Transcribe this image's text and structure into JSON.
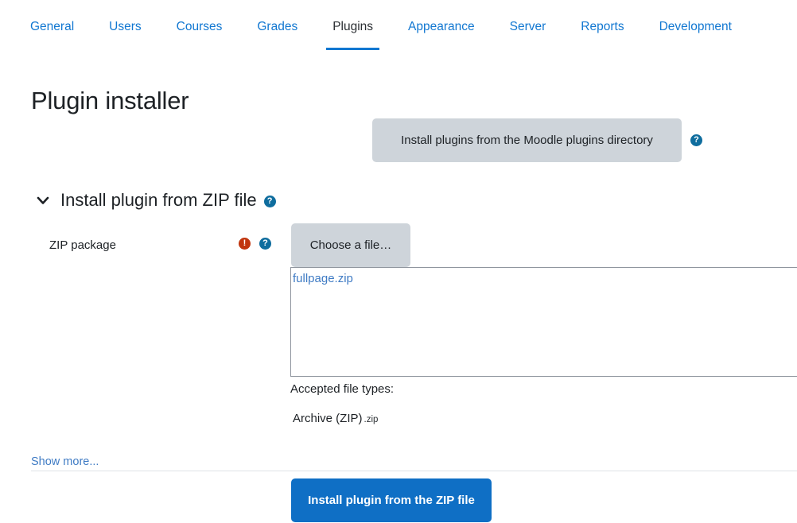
{
  "nav": {
    "tabs": [
      {
        "label": "General",
        "active": false
      },
      {
        "label": "Users",
        "active": false
      },
      {
        "label": "Courses",
        "active": false
      },
      {
        "label": "Grades",
        "active": false
      },
      {
        "label": "Plugins",
        "active": true
      },
      {
        "label": "Appearance",
        "active": false
      },
      {
        "label": "Server",
        "active": false
      },
      {
        "label": "Reports",
        "active": false
      },
      {
        "label": "Development",
        "active": false
      }
    ]
  },
  "page": {
    "title": "Plugin installer"
  },
  "directory": {
    "button_label": "Install plugins from the Moodle plugins directory",
    "help_icon_glyph": "?",
    "help_icon_name": "help-icon"
  },
  "zip_section": {
    "title": "Install plugin from ZIP file",
    "chevron_icon_name": "chevron-down-icon",
    "help_icon_glyph": "?",
    "expanded": true
  },
  "zip_field": {
    "label": "ZIP package",
    "required_icon_glyph": "!",
    "help_icon_glyph": "?",
    "choose_button_label": "Choose a file…",
    "selected_file": "fullpage.zip",
    "accepted_label": "Accepted file types:",
    "accepted_type_name": "Archive (ZIP)",
    "accepted_type_ext": ".zip"
  },
  "footer": {
    "show_more_label": "Show more...",
    "submit_label": "Install plugin from the ZIP file"
  },
  "colors": {
    "link_blue": "#1177d1",
    "primary_blue": "#0f6fc5",
    "help_teal": "#0f6d9e",
    "required_red": "#c1350e",
    "button_grey": "#ced4da",
    "text_dark": "#1d2125"
  }
}
